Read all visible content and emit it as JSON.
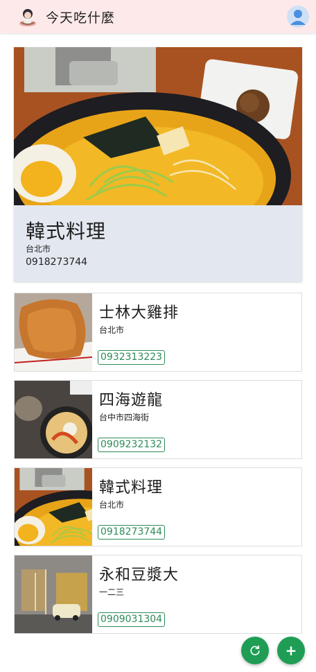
{
  "app": {
    "title": "今天吃什麼",
    "logo_icon": "girl-eating-ramen-icon",
    "avatar_icon": "user-avatar-icon"
  },
  "featured": {
    "name": "韓式料理",
    "city": "台北市",
    "phone": "0918273744",
    "image_icon": "ramen-bowl-photo"
  },
  "restaurants": [
    {
      "name": "士林大雞排",
      "city": "台北市",
      "phone": "0932313223",
      "image_icon": "fried-chicken-cutlet-photo"
    },
    {
      "name": "四海遊龍",
      "city": "台中市四海街",
      "phone": "0909232132",
      "image_icon": "bibimbap-meal-photo"
    },
    {
      "name": "韓式料理",
      "city": "台北市",
      "phone": "0918273744",
      "image_icon": "ramen-bowl-photo"
    },
    {
      "name": "永和豆漿大",
      "city": "一二三",
      "phone": "0909031304",
      "image_icon": "shop-street-photo"
    }
  ],
  "actions": {
    "refresh_icon": "refresh-icon",
    "add_label": "+",
    "add_icon": "plus-icon"
  },
  "colors": {
    "header_bg": "#fde9ea",
    "hero_bg": "#e3e8f0",
    "accent_green": "#1f9d55",
    "phone_green": "#2e8b57"
  }
}
